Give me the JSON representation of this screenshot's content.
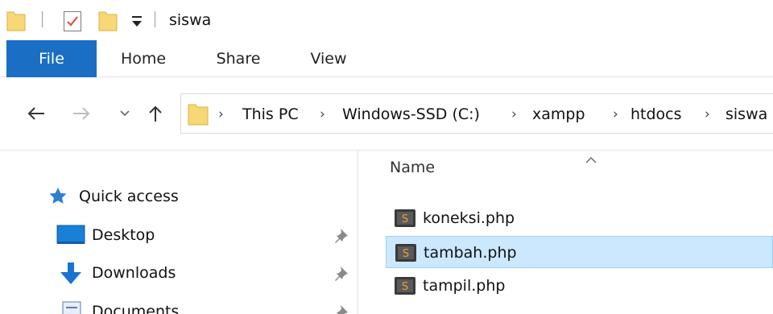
{
  "window": {
    "title": "siswa"
  },
  "ribbon": {
    "tabs": [
      {
        "label": "File",
        "active": true
      },
      {
        "label": "Home"
      },
      {
        "label": "Share"
      },
      {
        "label": "View"
      }
    ]
  },
  "address": {
    "breadcrumbs": [
      "This PC",
      "Windows-SSD (C:)",
      "xampp",
      "htdocs",
      "siswa"
    ]
  },
  "nav_pane": {
    "items": [
      {
        "label": "Quick access",
        "icon": "star-icon"
      },
      {
        "label": "Desktop",
        "icon": "desktop-icon",
        "pinned": true
      },
      {
        "label": "Downloads",
        "icon": "download-arrow-icon",
        "pinned": true
      },
      {
        "label": "Documents",
        "icon": "documents-icon",
        "pinned": true
      }
    ]
  },
  "file_list": {
    "column_name": "Name",
    "sort": "ascending",
    "files": [
      {
        "name": "koneksi.php",
        "icon": "php-file-icon"
      },
      {
        "name": "tambah.php",
        "icon": "php-file-icon",
        "selected": true
      },
      {
        "name": "tampil.php",
        "icon": "php-file-icon"
      }
    ]
  },
  "colors": {
    "file_tab": "#1a6ec4",
    "selection": "#cce8ff",
    "selection_border": "#99d1ff",
    "folder": "#f8d775"
  }
}
